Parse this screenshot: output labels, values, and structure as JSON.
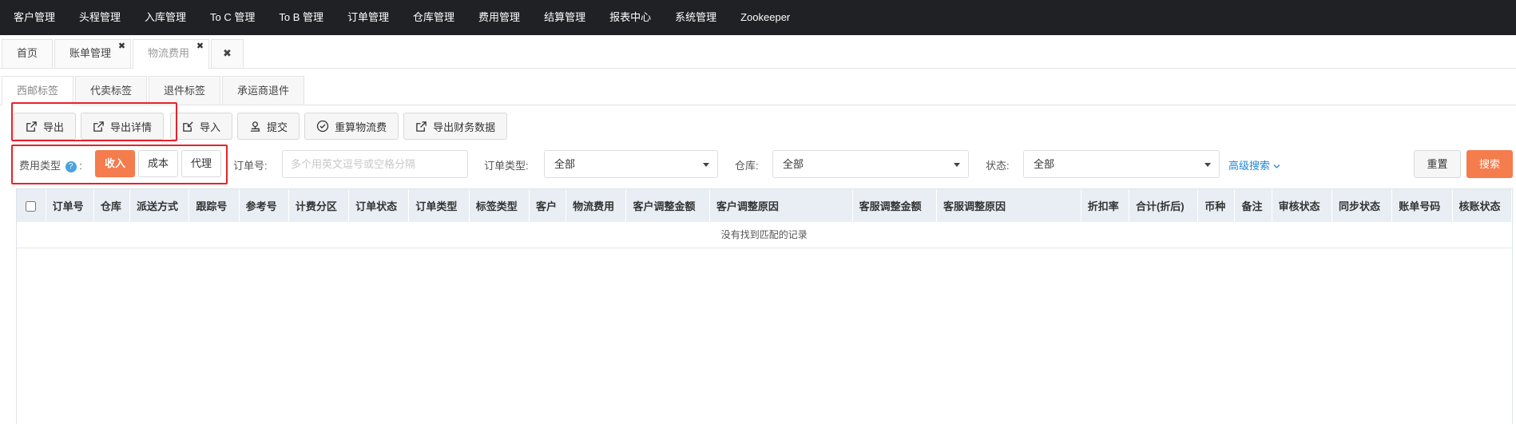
{
  "topnav": [
    "客户管理",
    "头程管理",
    "入库管理",
    "To C 管理",
    "To B 管理",
    "订单管理",
    "仓库管理",
    "费用管理",
    "结算管理",
    "报表中心",
    "系统管理",
    "Zookeeper"
  ],
  "pagetabs": [
    {
      "label": "首页"
    },
    {
      "label": "账单管理",
      "close": "✖"
    },
    {
      "label": "物流费用",
      "close": "✖"
    },
    {
      "label": "✖"
    }
  ],
  "subtabs": [
    "西邮标签",
    "代卖标签",
    "退件标签",
    "承运商退件"
  ],
  "toolbar": {
    "export": "导出",
    "export_detail": "导出详情",
    "import": "导入",
    "submit": "提交",
    "recalc": "重算物流费",
    "export_finance": "导出财务数据"
  },
  "filters": {
    "fee_type_label": "费用类型",
    "help": "?",
    "colon": ":",
    "fee_income": "收入",
    "fee_cost": "成本",
    "fee_agent": "代理",
    "order_no_label": "订单号:",
    "order_no_placeholder": "多个用英文逗号或空格分隔",
    "order_type_label": "订单类型:",
    "order_type_value": "全部",
    "warehouse_label": "仓库:",
    "warehouse_value": "全部",
    "status_label": "状态:",
    "status_value": "全部",
    "advanced": "高级搜索",
    "reset": "重置",
    "search": "搜索"
  },
  "table": {
    "columns": [
      "订单号",
      "仓库",
      "派送方式",
      "跟踪号",
      "参考号",
      "计费分区",
      "订单状态",
      "订单类型",
      "标签类型",
      "客户",
      "物流费用",
      "客户调整金额",
      "客户调整原因",
      "客服调整金额",
      "客服调整原因",
      "折扣率",
      "合计(折后)",
      "币种",
      "备注",
      "审核状态",
      "同步状态",
      "账单号码",
      "核账状态"
    ],
    "empty_text": "没有找到匹配的记录"
  },
  "colors": {
    "nav_bg": "#202124",
    "accent": "#f47c4d",
    "highlight": "#e8212b",
    "link": "#1e88d8"
  }
}
